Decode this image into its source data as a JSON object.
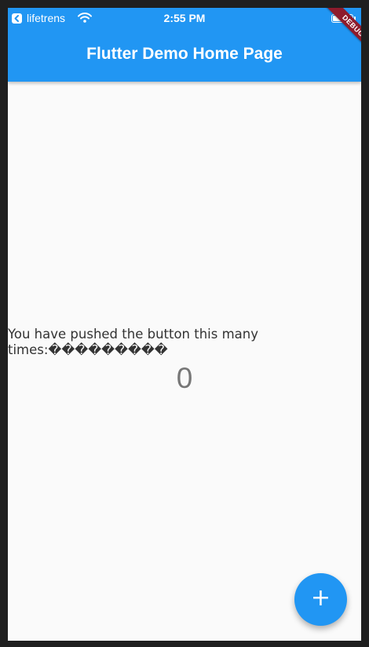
{
  "status_bar": {
    "carrier": "lifetrens",
    "time": "2:55 PM",
    "icons": [
      "back-to-app-icon",
      "wifi-icon",
      "battery-icon"
    ]
  },
  "app_bar": {
    "title": "Flutter Demo Home Page",
    "color": "#2196f3"
  },
  "debug_banner": {
    "label": "DEBUG",
    "color": "#8e1b2c"
  },
  "main": {
    "message": "You have pushed the button this many times:���������",
    "counter": "0"
  },
  "fab": {
    "icon": "plus-icon",
    "glyph": "+"
  }
}
